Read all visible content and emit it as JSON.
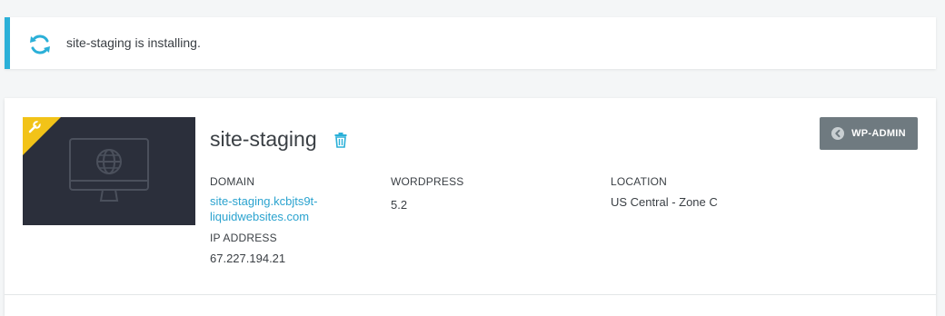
{
  "notice": {
    "message": "site-staging is installing.",
    "icon": "sync-icon",
    "accent_color": "#2bb0d8"
  },
  "site": {
    "name": "site-staging",
    "badge_icon": "wrench-icon",
    "badge_color": "#f2c318",
    "domain_label": "DOMAIN",
    "domain_line1": "site-staging.kcbjts9t-",
    "domain_line2": "liquidwebsites.com",
    "ip_label": "IP ADDRESS",
    "ip_value": "67.227.194.21",
    "wordpress_label": "WORDPRESS",
    "wordpress_value": "5.2",
    "location_label": "LOCATION",
    "location_value": "US Central - Zone C",
    "wp_admin_label": "WP-ADMIN",
    "link_color": "#2ba3cf"
  }
}
